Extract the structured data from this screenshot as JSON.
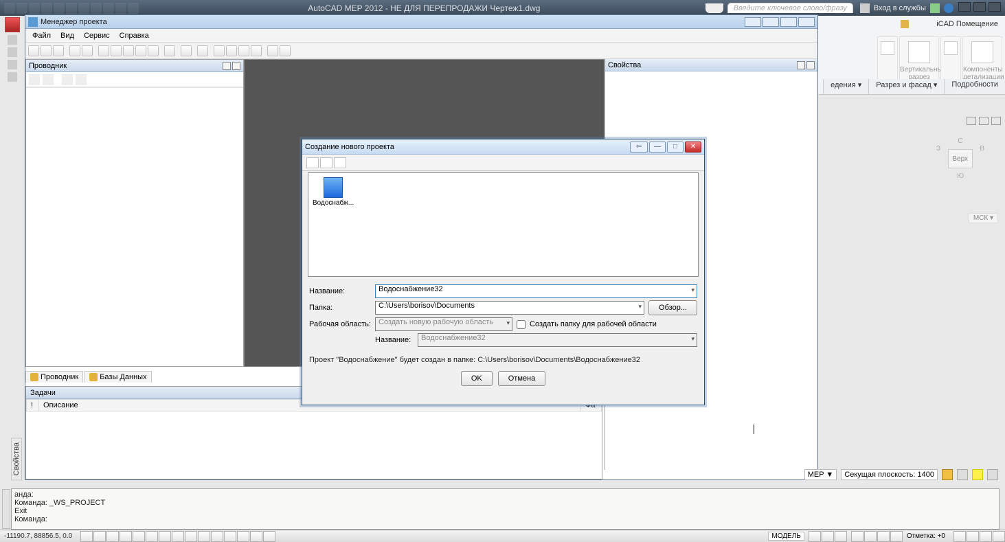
{
  "app": {
    "title": "AutoCAD MEP 2012 - НЕ ДЛЯ ПЕРЕПРОДАЖИ   Чертеж1.dwg",
    "search_placeholder": "Введите ключевое слово/фразу",
    "login": "Вход в службы"
  },
  "ribbon": {
    "workspace": "iCAD Помещение",
    "big": [
      "Вертикальный разрез",
      "Компоненты детализации"
    ],
    "tabs": [
      "едения ▾",
      "Разрез и фасад ▾",
      "Подробности"
    ]
  },
  "pm": {
    "title": "Менеджер проекта",
    "menu": [
      "Файл",
      "Вид",
      "Сервис",
      "Справка"
    ],
    "explorer": "Проводник",
    "properties": "Свойства",
    "bottom_tabs": [
      "Проводник",
      "Базы Данных"
    ],
    "tasks_title": "Задачи",
    "tasks_cols": [
      "!",
      "Описание",
      "Фа"
    ]
  },
  "dlg": {
    "title": "Создание нового проекта",
    "template": "Водоснабж...",
    "name_label": "Название:",
    "name_value": "Водоснабжение32",
    "folder_label": "Папка:",
    "folder_value": "C:\\Users\\borisov\\Documents",
    "browse": "Обзор...",
    "ws_label": "Рабочая область:",
    "ws_value": "Создать новую рабочую область",
    "ws_chk": "Создать папку для рабочей области",
    "ws_name_label": "Название:",
    "ws_name_value": "Водоснабжение32",
    "info": "Проект \"Водоснабжение\" будет создан в папке: C:\\Users\\borisov\\Documents\\Водоснабжение32",
    "ok": "OK",
    "cancel": "Отмена"
  },
  "viewcube": {
    "n": "С",
    "s": "Ю",
    "e": "В",
    "w": "З",
    "top": "Верх",
    "wcs": "МСК ▾"
  },
  "cmd": {
    "l1": "анда:",
    "l2": "Команда: _WS_PROJECT",
    "l3": "Exit",
    "prompt": "Команда:"
  },
  "status": {
    "coords": "-11190.7, 88856.5, 0.0",
    "mep": "MEP ▼",
    "cut": "Секущая плоскость: 1400",
    "model": "МОДЕЛЬ",
    "elev": "Отметка: +0"
  },
  "side_props": "Свойства"
}
